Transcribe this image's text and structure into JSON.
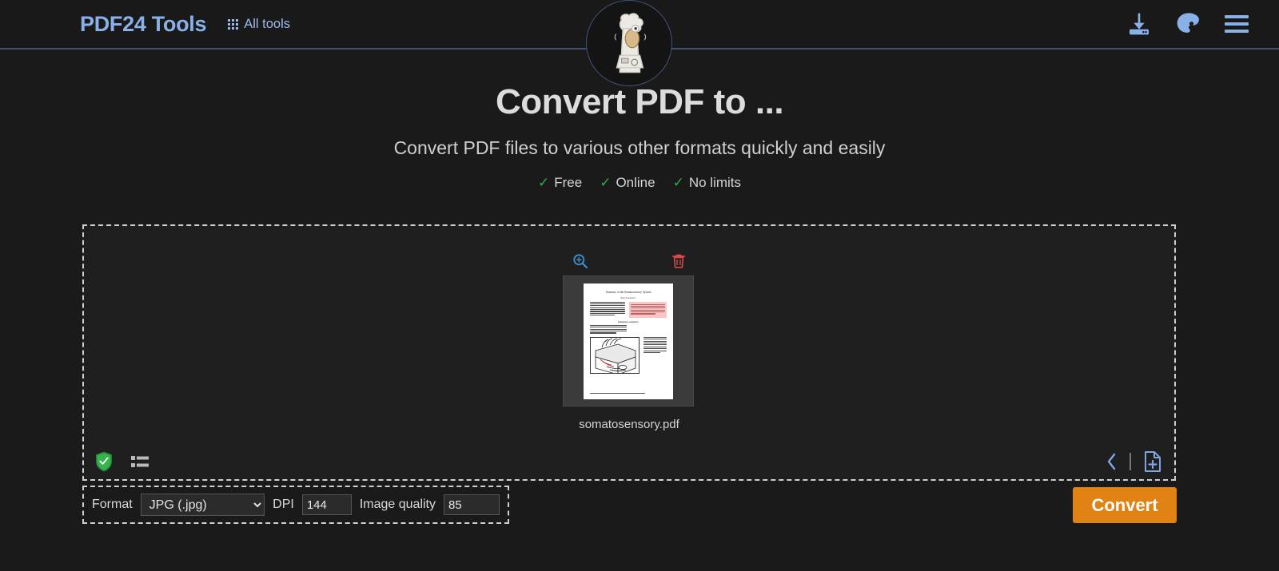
{
  "header": {
    "brand": "PDF24 Tools",
    "all_tools_label": "All tools",
    "logo_alt": "blender-logo",
    "icons": {
      "download": "download-icon",
      "theme": "palette-icon",
      "menu": "hamburger-menu-icon"
    },
    "accent_color": "#8ab0e8",
    "border_color": "#3f5070"
  },
  "hero": {
    "title": "Convert PDF to ...",
    "subtitle": "Convert PDF files to various other formats quickly and easily",
    "features": [
      {
        "check": "✓",
        "label": "Free"
      },
      {
        "check": "✓",
        "label": "Online"
      },
      {
        "check": "✓",
        "label": "No limits"
      }
    ],
    "check_color": "#2eae4e"
  },
  "dropzone": {
    "file": {
      "name": "somatosensory.pdf",
      "zoom_icon": "magnifier-plus-icon",
      "delete_icon": "trash-icon"
    },
    "preview": {
      "doc_title": "Anatomy of the Somatosensory System",
      "doc_author": "Peter Friedmann*",
      "section_heading": "Cutaneous receptors"
    },
    "bottom_left": {
      "security_icon": "shield-check-icon",
      "list_view_icon": "list-view-icon"
    },
    "bottom_right": {
      "prev_icon": "chevron-left-icon",
      "add_file_icon": "add-file-icon"
    }
  },
  "options": {
    "format_label": "Format",
    "format_value": "JPG (.jpg)",
    "format_options": [
      "JPG (.jpg)"
    ],
    "dpi_label": "DPI",
    "dpi_value": "144",
    "quality_label": "Image quality",
    "quality_value": "85"
  },
  "actions": {
    "convert_label": "Convert",
    "convert_color": "#e08214"
  }
}
